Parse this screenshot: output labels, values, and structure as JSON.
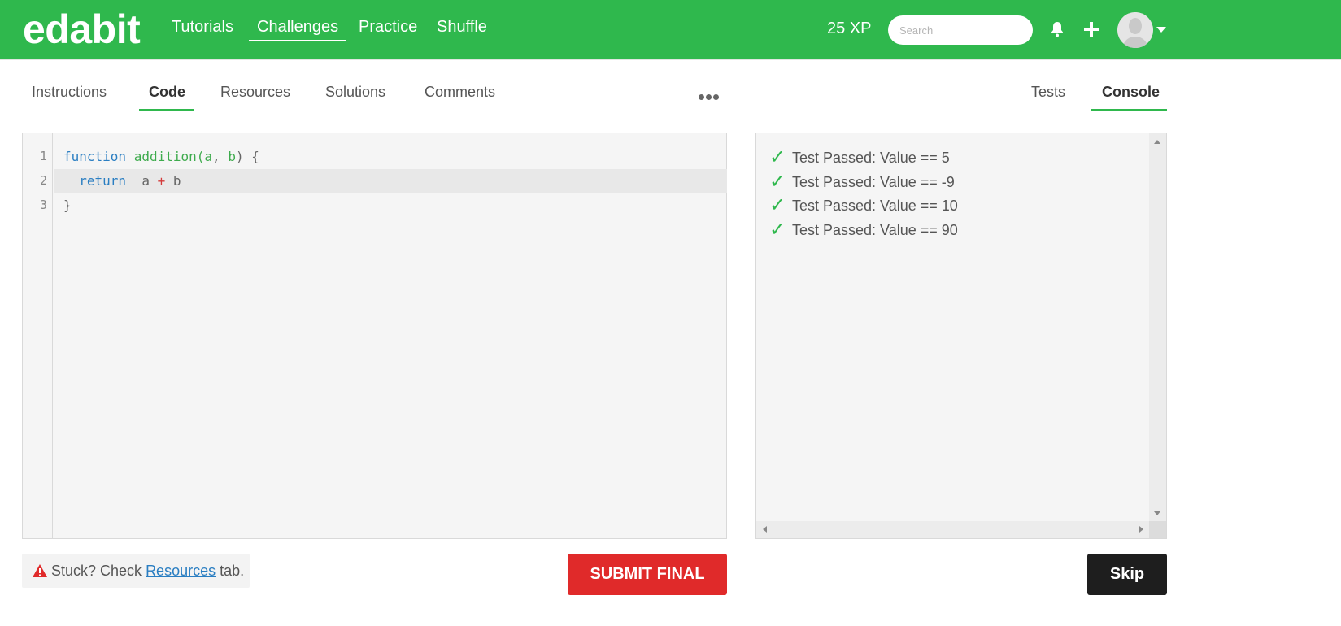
{
  "header": {
    "logo": "edabit",
    "nav": [
      "Tutorials",
      "Challenges",
      "Practice",
      "Shuffle"
    ],
    "active_nav": "Challenges",
    "xp": "25 XP",
    "search_placeholder": "Search",
    "icons": [
      "bell-icon",
      "plus-icon",
      "avatar",
      "chevron-down-icon"
    ],
    "bg_color": "#2fb84d"
  },
  "tabs_left": [
    "Instructions",
    "Code",
    "Resources",
    "Solutions",
    "Comments"
  ],
  "active_left_tab": "Code",
  "tabs_right": [
    "Tests",
    "Console"
  ],
  "active_right_tab": "Console",
  "editor": {
    "line_numbers": [
      "1",
      "2",
      "3"
    ],
    "lines": [
      {
        "kw": "function",
        "fn": "addition",
        "open": "(",
        "a": "a",
        "comma": ", ",
        "b": "b",
        "close": ") {"
      },
      {
        "indent": "  ",
        "kw": "return",
        "a": "a",
        "op": "+",
        "b": "b"
      },
      {
        "text": "}"
      }
    ],
    "highlighted_line": 2
  },
  "console": {
    "results": [
      "Test Passed: Value == 5",
      "Test Passed: Value == -9",
      "Test Passed: Value == 10",
      "Test Passed: Value == 90"
    ],
    "check_icon": "check-icon"
  },
  "footer": {
    "stuck_prefix": "Stuck? Check ",
    "stuck_link": "Resources",
    "stuck_suffix": " tab.",
    "submit_label": "SUBMIT FINAL",
    "skip_label": "Skip",
    "submit_color": "#e02a2a",
    "skip_color": "#1e1e1e"
  }
}
